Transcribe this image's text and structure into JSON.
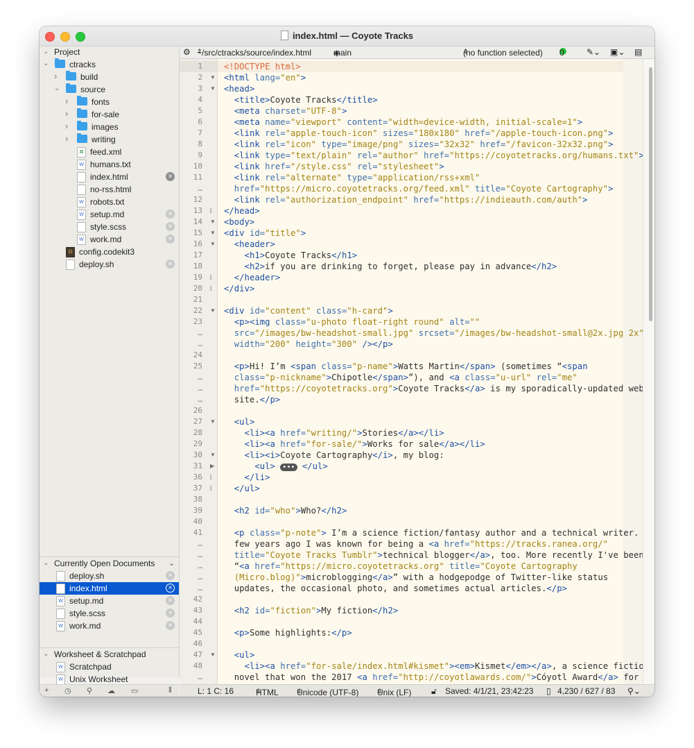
{
  "window": {
    "title": "index.html — Coyote Tracks"
  },
  "sidebar": {
    "project_header": "Project",
    "tree": [
      {
        "label": "ctracks",
        "kind": "folder",
        "depth": 0,
        "chev": "v"
      },
      {
        "label": "build",
        "kind": "folder",
        "depth": 1,
        "chev": ">"
      },
      {
        "label": "source",
        "kind": "folder",
        "depth": 1,
        "chev": "v"
      },
      {
        "label": "fonts",
        "kind": "folder",
        "depth": 2,
        "chev": ">"
      },
      {
        "label": "for-sale",
        "kind": "folder",
        "depth": 2,
        "chev": ">"
      },
      {
        "label": "images",
        "kind": "folder",
        "depth": 2,
        "chev": ">"
      },
      {
        "label": "writing",
        "kind": "folder",
        "depth": 2,
        "chev": ">"
      },
      {
        "label": "feed.xml",
        "kind": "feed",
        "depth": 2
      },
      {
        "label": "humans.txt",
        "kind": "file",
        "depth": 2
      },
      {
        "label": "index.html",
        "kind": "plain",
        "depth": 2,
        "close": "dark"
      },
      {
        "label": "no-rss.html",
        "kind": "plain",
        "depth": 2
      },
      {
        "label": "robots.txt",
        "kind": "file",
        "depth": 2
      },
      {
        "label": "setup.md",
        "kind": "file",
        "depth": 2,
        "close": "light"
      },
      {
        "label": "style.scss",
        "kind": "plain",
        "depth": 2,
        "close": "light"
      },
      {
        "label": "work.md",
        "kind": "file",
        "depth": 2,
        "close": "light"
      },
      {
        "label": "config.codekit3",
        "kind": "codekit",
        "depth": 1
      },
      {
        "label": "deploy.sh",
        "kind": "plain",
        "depth": 1,
        "close": "light"
      }
    ],
    "open_docs_header": "Currently Open Documents",
    "open_docs": [
      {
        "label": "deploy.sh",
        "kind": "plain"
      },
      {
        "label": "index.html",
        "kind": "plain",
        "selected": true
      },
      {
        "label": "setup.md",
        "kind": "file"
      },
      {
        "label": "style.scss",
        "kind": "plain"
      },
      {
        "label": "work.md",
        "kind": "file"
      }
    ],
    "worksheet_header": "Worksheet & Scratchpad",
    "worksheet": [
      {
        "label": "Scratchpad",
        "kind": "file"
      },
      {
        "label": "Unix Worksheet",
        "kind": "file"
      }
    ],
    "footer": {
      "plus": "+",
      "clock": "◷",
      "search": "⚲",
      "cloud": "☁",
      "panel": "▭",
      "resize": "⦀"
    }
  },
  "pathbar": {
    "path": "~/src/ctracks/source/index.html",
    "branch": "main",
    "function": "(no function selected)",
    "issues": "0"
  },
  "editor": {
    "lines": [
      {
        "n": "1",
        "f": "",
        "h": "<span class='d'>&lt;!DOCTYPE html&gt;</span>"
      },
      {
        "n": "2",
        "f": "▼",
        "h": "<span class='t'>&lt;html</span> <span class='a'>lang=</span><span class='s'>\"en\"</span><span class='t'>&gt;</span>"
      },
      {
        "n": "3",
        "f": "▼",
        "h": "<span class='t'>&lt;head&gt;</span>"
      },
      {
        "n": "4",
        "f": "",
        "h": "  <span class='t'>&lt;title&gt;</span>Coyote Tracks<span class='t'>&lt;/title&gt;</span>"
      },
      {
        "n": "5",
        "f": "",
        "h": "  <span class='t'>&lt;meta</span> <span class='a'>charset=</span><span class='s'>\"UTF-8\"</span><span class='t'>&gt;</span>"
      },
      {
        "n": "6",
        "f": "",
        "h": "  <span class='t'>&lt;meta</span> <span class='a'>name=</span><span class='s'>\"viewport\"</span> <span class='a'>content=</span><span class='s'>\"width=device-width, initial-scale=1\"</span><span class='t'>&gt;</span>"
      },
      {
        "n": "7",
        "f": "",
        "h": "  <span class='t'>&lt;link</span> <span class='a'>rel=</span><span class='s'>\"apple-touch-icon\"</span> <span class='a'>sizes=</span><span class='s'>\"180x180\"</span> <span class='a'>href=</span><span class='s'>\"/apple-touch-icon.png\"</span><span class='t'>&gt;</span>"
      },
      {
        "n": "8",
        "f": "",
        "h": "  <span class='t'>&lt;link</span> <span class='a'>rel=</span><span class='s'>\"icon\"</span> <span class='a'>type=</span><span class='s'>\"image/png\"</span> <span class='a'>sizes=</span><span class='s'>\"32x32\"</span> <span class='a'>href=</span><span class='s'>\"/favicon-32x32.png\"</span><span class='t'>&gt;</span>"
      },
      {
        "n": "9",
        "f": "",
        "h": "  <span class='t'>&lt;link</span> <span class='a'>type=</span><span class='s'>\"text/plain\"</span> <span class='a'>rel=</span><span class='s'>\"author\"</span> <span class='a'>href=</span><span class='s'>\"https://coyotetracks.org/humans.txt\"</span><span class='t'>&gt;</span>"
      },
      {
        "n": "10",
        "f": "",
        "h": "  <span class='t'>&lt;link</span> <span class='a'>href=</span><span class='s'>\"/style.css\"</span> <span class='a'>rel=</span><span class='s'>\"stylesheet\"</span><span class='t'>&gt;</span>"
      },
      {
        "n": "11",
        "f": "",
        "h": "  <span class='t'>&lt;link</span> <span class='a'>rel=</span><span class='s'>\"alternate\"</span> <span class='a'>type=</span><span class='s'>\"application/rss+xml\"</span>"
      },
      {
        "n": "…",
        "f": "",
        "h": "  <span class='a'>href=</span><span class='s'>\"https://micro.coyotetracks.org/feed.xml\"</span> <span class='a'>title=</span><span class='s'>\"Coyote Cartography\"</span><span class='t'>&gt;</span>"
      },
      {
        "n": "12",
        "f": "",
        "h": "  <span class='t'>&lt;link</span> <span class='a'>rel=</span><span class='s'>\"authorization_endpoint\"</span> <span class='a'>href=</span><span class='s'>\"https://indieauth.com/auth\"</span><span class='t'>&gt;</span>"
      },
      {
        "n": "13",
        "f": "⌊",
        "h": "<span class='t'>&lt;/head&gt;</span>"
      },
      {
        "n": "14",
        "f": "▼",
        "h": "<span class='t'>&lt;body&gt;</span>"
      },
      {
        "n": "15",
        "f": "▼",
        "h": "<span class='t'>&lt;div</span> <span class='a'>id=</span><span class='s'>\"title\"</span><span class='t'>&gt;</span>"
      },
      {
        "n": "16",
        "f": "▼",
        "h": "  <span class='t'>&lt;header&gt;</span>"
      },
      {
        "n": "17",
        "f": "",
        "h": "    <span class='t'>&lt;h1&gt;</span>Coyote Tracks<span class='t'>&lt;/h1&gt;</span>"
      },
      {
        "n": "18",
        "f": "",
        "h": "    <span class='t'>&lt;h2&gt;</span>if you are drinking to forget, please pay in advance<span class='t'>&lt;/h2&gt;</span>"
      },
      {
        "n": "19",
        "f": "⌊",
        "h": "  <span class='t'>&lt;/header&gt;</span>"
      },
      {
        "n": "20",
        "f": "⌊",
        "h": "<span class='t'>&lt;/div&gt;</span>"
      },
      {
        "n": "21",
        "f": "",
        "h": ""
      },
      {
        "n": "22",
        "f": "▼",
        "h": "<span class='t'>&lt;div</span> <span class='a'>id=</span><span class='s'>\"content\"</span> <span class='a'>class=</span><span class='s'>\"h-card\"</span><span class='t'>&gt;</span>"
      },
      {
        "n": "23",
        "f": "",
        "h": "  <span class='t'>&lt;p&gt;&lt;img</span> <span class='a'>class=</span><span class='s'>\"u-photo float-right round\"</span> <span class='a'>alt=</span><span class='s'>\"\"</span>"
      },
      {
        "n": "…",
        "f": "",
        "h": "  <span class='a'>src=</span><span class='s'>\"/images/bw-headshot-small.jpg\"</span> <span class='a'>srcset=</span><span class='s'>\"/images/bw-headshot-small@2x.jpg 2x\"</span>"
      },
      {
        "n": "…",
        "f": "",
        "h": "  <span class='a'>width=</span><span class='s'>\"200\"</span> <span class='a'>height=</span><span class='s'>\"300\"</span> <span class='t'>/&gt;&lt;/p&gt;</span>"
      },
      {
        "n": "24",
        "f": "",
        "h": ""
      },
      {
        "n": "25",
        "f": "",
        "h": "  <span class='t'>&lt;p&gt;</span>Hi! I’m <span class='t'>&lt;span</span> <span class='a'>class=</span><span class='s'>\"p-name\"</span><span class='t'>&gt;</span>Watts Martin<span class='t'>&lt;/span&gt;</span> (sometimes “<span class='t'>&lt;span</span>"
      },
      {
        "n": "…",
        "f": "",
        "h": "  <span class='a'>class=</span><span class='s'>\"p-nickname\"</span><span class='t'>&gt;</span>Chipotle<span class='t'>&lt;/span&gt;</span>”), and <span class='t'>&lt;a</span> <span class='a'>class=</span><span class='s'>\"u-url\"</span> <span class='a'>rel=</span><span class='s'>\"me\"</span>"
      },
      {
        "n": "…",
        "f": "",
        "h": "  <span class='a'>href=</span><span class='s'>\"https://coyotetracks.org\"</span><span class='t'>&gt;</span>Coyote Tracks<span class='t'>&lt;/a&gt;</span> is my sporadically-updated web"
      },
      {
        "n": "…",
        "f": "",
        "h": "  site.<span class='t'>&lt;/p&gt;</span>"
      },
      {
        "n": "26",
        "f": "",
        "h": ""
      },
      {
        "n": "27",
        "f": "▼",
        "h": "  <span class='t'>&lt;ul&gt;</span>"
      },
      {
        "n": "28",
        "f": "",
        "h": "    <span class='t'>&lt;li&gt;&lt;a</span> <span class='a'>href=</span><span class='s'>\"writing/\"</span><span class='t'>&gt;</span>Stories<span class='t'>&lt;/a&gt;&lt;/li&gt;</span>"
      },
      {
        "n": "29",
        "f": "",
        "h": "    <span class='t'>&lt;li&gt;&lt;a</span> <span class='a'>href=</span><span class='s'>\"for-sale/\"</span><span class='t'>&gt;</span>Works for sale<span class='t'>&lt;/a&gt;&lt;/li&gt;</span>"
      },
      {
        "n": "30",
        "f": "▼",
        "h": "    <span class='t'>&lt;li&gt;&lt;i&gt;</span>Coyote Cartography<span class='t'>&lt;/i&gt;</span>, my blog:"
      },
      {
        "n": "31",
        "f": "▶",
        "h": "      <span class='t'>&lt;ul&gt;</span> <span style='background:#555;color:#fff;border-radius:6px;padding:0 3px;font-size:10px;'>•••</span> <span class='t'>&lt;/ul&gt;</span>"
      },
      {
        "n": "36",
        "f": "⌊",
        "h": "    <span class='t'>&lt;/li&gt;</span>"
      },
      {
        "n": "37",
        "f": "⌊",
        "h": "  <span class='t'>&lt;/ul&gt;</span>"
      },
      {
        "n": "38",
        "f": "",
        "h": ""
      },
      {
        "n": "39",
        "f": "",
        "h": "  <span class='t'>&lt;h2</span> <span class='a'>id=</span><span class='s'>\"who\"</span><span class='t'>&gt;</span>Who?<span class='t'>&lt;/h2&gt;</span>"
      },
      {
        "n": "40",
        "f": "",
        "h": ""
      },
      {
        "n": "41",
        "f": "",
        "h": "  <span class='t'>&lt;p</span> <span class='a'>class=</span><span class='s'>\"p-note\"</span><span class='t'>&gt;</span> I’m a science fiction/fantasy author and a technical writer. A"
      },
      {
        "n": "…",
        "f": "",
        "h": "  few years ago I was known for being a <span class='t'>&lt;a</span> <span class='a'>href=</span><span class='s'>\"https://tracks.ranea.org/\"</span>"
      },
      {
        "n": "…",
        "f": "",
        "h": "  <span class='a'>title=</span><span class='s'>\"Coyote Tracks Tumblr\"</span><span class='t'>&gt;</span>technical blogger<span class='t'>&lt;/a&gt;</span>, too. More recently I've been"
      },
      {
        "n": "…",
        "f": "",
        "h": "  “<span class='t'>&lt;a</span> <span class='a'>href=</span><span class='s'>\"https://micro.coyotetracks.org\"</span> <span class='a'>title=</span><span class='s'>\"Coyote Cartography</span>"
      },
      {
        "n": "…",
        "f": "",
        "h": "  <span class='s'>(Micro.blog)\"</span><span class='t'>&gt;</span>microblogging<span class='t'>&lt;/a&gt;</span>” with a hodgepodge of Twitter-like status"
      },
      {
        "n": "…",
        "f": "",
        "h": "  updates, the occasional photo, and sometimes actual articles.<span class='t'>&lt;/p&gt;</span>"
      },
      {
        "n": "42",
        "f": "",
        "h": ""
      },
      {
        "n": "43",
        "f": "",
        "h": "  <span class='t'>&lt;h2</span> <span class='a'>id=</span><span class='s'>\"fiction\"</span><span class='t'>&gt;</span>My fiction<span class='t'>&lt;/h2&gt;</span>"
      },
      {
        "n": "44",
        "f": "",
        "h": ""
      },
      {
        "n": "45",
        "f": "",
        "h": "  <span class='t'>&lt;p&gt;</span>Some highlights:<span class='t'>&lt;/p&gt;</span>"
      },
      {
        "n": "46",
        "f": "",
        "h": ""
      },
      {
        "n": "47",
        "f": "▼",
        "h": "  <span class='t'>&lt;ul&gt;</span>"
      },
      {
        "n": "48",
        "f": "",
        "h": "    <span class='t'>&lt;li&gt;&lt;a</span> <span class='a'>href=</span><span class='s'>\"for-sale/index.html#kismet\"</span><span class='t'>&gt;&lt;em&gt;</span>Kismet<span class='t'>&lt;/em&gt;&lt;/a&gt;</span>, a science fiction"
      },
      {
        "n": "…",
        "f": "",
        "h": "  novel that won the 2017 <span class='t'>&lt;a</span> <span class='a'>href=</span><span class='s'>\"http://coyotlawards.com/\"</span><span class='t'>&gt;</span>Cóyotl Award<span class='t'>&lt;/a&gt;</span> for"
      }
    ]
  },
  "statusbar": {
    "position": "L: 1 C: 16",
    "language": "HTML",
    "encoding": "Unicode (UTF-8)",
    "line_endings": "Unix (LF)",
    "saved": "Saved: 4/1/21, 23:42:23",
    "counts": "4,230 / 627 / 83"
  }
}
